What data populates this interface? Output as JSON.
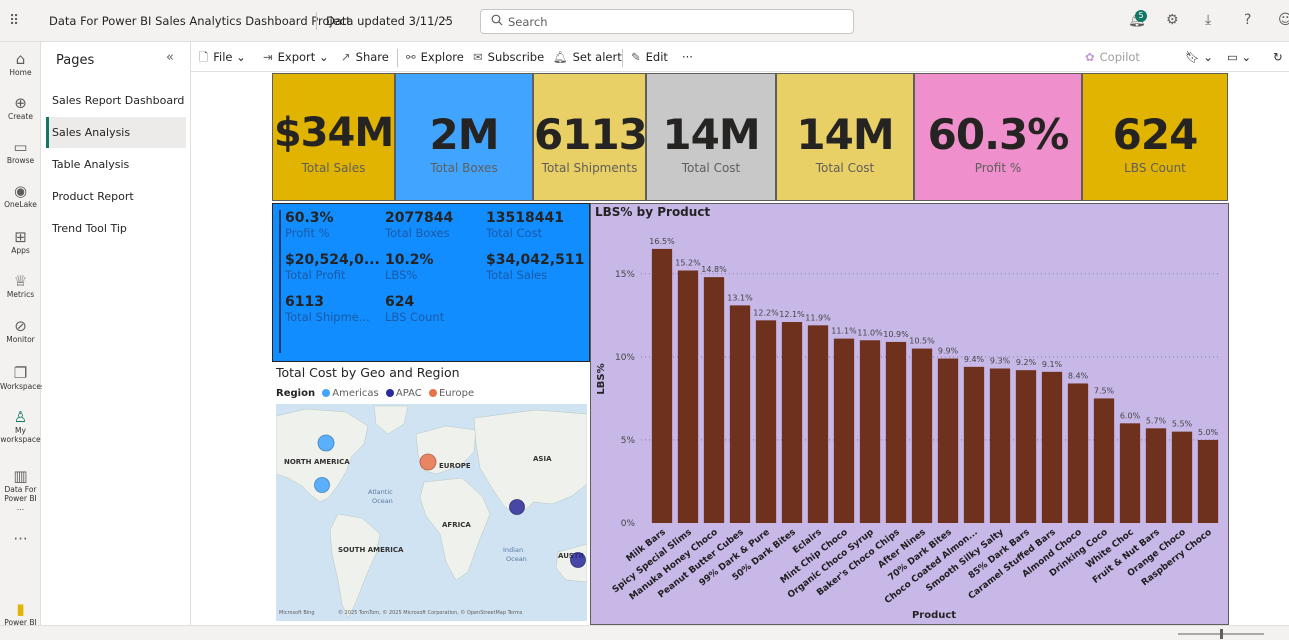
{
  "header": {
    "app_title": "Data For Power BI Sales Analytics Dashboard Project",
    "updated": "Data updated 3/11/25",
    "search_placeholder": "Search",
    "notification_count": "5"
  },
  "left_rail": [
    {
      "label": "Home",
      "icon": "home-icon"
    },
    {
      "label": "Create",
      "icon": "create-icon"
    },
    {
      "label": "Browse",
      "icon": "browse-icon"
    },
    {
      "label": "OneLake",
      "icon": "onelake-icon"
    },
    {
      "label": "Apps",
      "icon": "apps-icon"
    },
    {
      "label": "Metrics",
      "icon": "metrics-icon"
    },
    {
      "label": "Monitor",
      "icon": "monitor-icon"
    },
    {
      "label": "Workspaces",
      "icon": "workspaces-icon"
    },
    {
      "label": "My workspace",
      "icon": "my-workspace-icon"
    },
    {
      "label": "Data For Power BI ...",
      "icon": "report-icon"
    },
    {
      "label": "Power BI",
      "icon": "powerbi-icon"
    }
  ],
  "pages_panel": {
    "title": "Pages",
    "items": [
      "Sales Report Dashboard",
      "Sales Analysis",
      "Table Analysis",
      "Product Report",
      "Trend Tool Tip"
    ],
    "active_index": 1
  },
  "toolbar": {
    "file": "File",
    "export": "Export",
    "share": "Share",
    "explore": "Explore",
    "subscribe": "Subscribe",
    "set_alert": "Set alert",
    "edit": "Edit",
    "more": "···",
    "copilot": "Copilot"
  },
  "kpi_cards": [
    {
      "value": "$34M",
      "label": "Total Sales",
      "color": "#e0b400"
    },
    {
      "value": "2M",
      "label": "Total Boxes",
      "color": "#41a5ff"
    },
    {
      "value": "6113",
      "label": "Total Shipments",
      "color": "#e8cf66"
    },
    {
      "value": "14M",
      "label": "Total Cost",
      "color": "#c8c8c8"
    },
    {
      "value": "14M",
      "label": "Total Cost",
      "color": "#e8cf66"
    },
    {
      "value": "60.3%",
      "label": "Profit %",
      "color": "#ef8fcb"
    },
    {
      "value": "624",
      "label": "LBS Count",
      "color": "#e0b400"
    }
  ],
  "multi_card": [
    {
      "value": "60.3%",
      "label": "Profit %"
    },
    {
      "value": "2077844",
      "label": "Total Boxes"
    },
    {
      "value": "13518441",
      "label": "Total Cost"
    },
    {
      "value": "$20,524,0...",
      "label": "Total Profit"
    },
    {
      "value": "10.2%",
      "label": "LBS%"
    },
    {
      "value": "$34,042,511",
      "label": "Total Sales"
    },
    {
      "value": "6113",
      "label": "Total Shipme..."
    },
    {
      "value": "624",
      "label": "LBS Count"
    }
  ],
  "map": {
    "title": "Total Cost by Geo and Region",
    "legend_title": "Region",
    "legend": [
      {
        "name": "Americas",
        "color": "#41a5ff"
      },
      {
        "name": "APAC",
        "color": "#2a2a9a"
      },
      {
        "name": "Europe",
        "color": "#e8734a"
      }
    ],
    "labels": [
      "NORTH AMERICA",
      "EUROPE",
      "ASIA",
      "Atlantic",
      "Ocean",
      "AFRICA",
      "SOUTH AMERICA",
      "Indian",
      "Ocean",
      "AUSTR"
    ],
    "attribution": "© 2025 TomTom, © 2025 Microsoft Corporation, © OpenStreetMap  Terms",
    "bing": "Microsoft Bing"
  },
  "chart_data": {
    "type": "bar",
    "title": "LBS% by Product",
    "xlabel": "Product",
    "ylabel": "LBS%",
    "ylim": [
      0,
      0.18
    ],
    "yticks": [
      "0%",
      "5%",
      "10%",
      "15%"
    ],
    "categories": [
      "Milk Bars",
      "Spicy Special Slims",
      "Manuka Honey Choco",
      "Peanut Butter Cubes",
      "99% Dark & Pure",
      "50% Dark Bites",
      "Eclairs",
      "Mint Chip Choco",
      "Organic Choco Syrup",
      "Baker's Choco Chips",
      "After Nines",
      "70% Dark Bites",
      "Choco Coated Almon...",
      "Smooth Silky Salty",
      "85% Dark Bars",
      "Caramel Stuffed Bars",
      "Almond Choco",
      "Drinking Coco",
      "White Choc",
      "Fruit & Nut Bars",
      "Orange Choco",
      "Raspberry Choco"
    ],
    "values": [
      0.165,
      0.152,
      0.148,
      0.131,
      0.122,
      0.121,
      0.119,
      0.111,
      0.11,
      0.109,
      0.105,
      0.099,
      0.094,
      0.093,
      0.092,
      0.091,
      0.084,
      0.075,
      0.06,
      0.057,
      0.055,
      0.05
    ],
    "data_labels": [
      "16.5%",
      "15.2%",
      "14.8%",
      "13.1%",
      "12.2%",
      "12.1%",
      "11.9%",
      "11.1%",
      "11.0%",
      "10.9%",
      "10.5%",
      "9.9%",
      "9.4%",
      "9.3%",
      "9.2%",
      "9.1%",
      "8.4%",
      "7.5%",
      "6.0%",
      "5.7%",
      "5.5%",
      "5.0%"
    ],
    "bar_color": "#6e311e",
    "background": "#c8b8e8",
    "grid": true
  }
}
